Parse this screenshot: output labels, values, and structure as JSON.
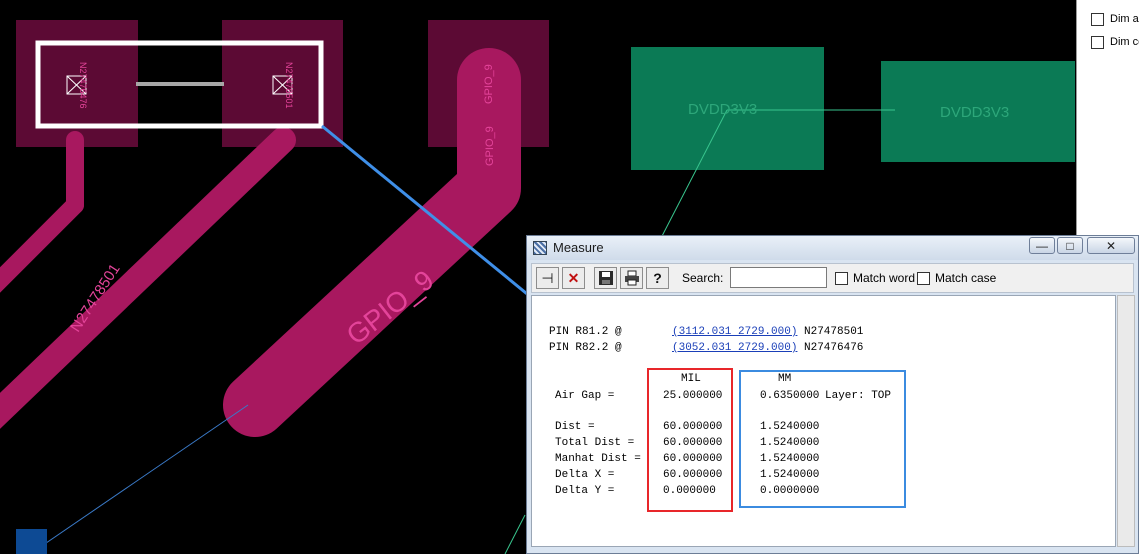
{
  "colors": {
    "background": "#000000",
    "pad": "#5c0a34",
    "trace": "#a8185f",
    "trace_label": "#e4449a",
    "copper_green": "#0b7a55",
    "green_label": "#2da77a",
    "highlight_white": "#ffffff",
    "arrow_blue": "#3f8fe8",
    "box_red": "#e8262a",
    "box_blue": "#3b8be0",
    "window_frame": "#d9e4f1"
  },
  "pcb": {
    "pad_labels": [
      "N27476476",
      "N27478501"
    ],
    "trace_labels": [
      "N27478501",
      "GPIO_9",
      "GPIO_9",
      "GPIO_9"
    ],
    "region_labels": [
      "DVDD3V3",
      "DVDD3V3"
    ]
  },
  "options_panel": {
    "items": [
      "Dim ac",
      "Dim cc"
    ]
  },
  "measure": {
    "title": "Measure",
    "window_buttons": {
      "minimize": "—",
      "maximize": "□",
      "close": "✕"
    },
    "toolbar": {
      "icons": [
        "pin-icon",
        "delete-icon",
        "save-icon",
        "print-icon",
        "help-icon"
      ],
      "search_label": "Search:",
      "search_value": "",
      "match_word": "Match word",
      "match_case": "Match case"
    },
    "pins": [
      {
        "label": "PIN R81.2 @",
        "coords": "(3112.031 2729.000)",
        "net": "N27478501"
      },
      {
        "label": "PIN R82.2 @",
        "coords": "(3052.031 2729.000)",
        "net": "N27476476"
      }
    ],
    "headers": {
      "mil": "MIL",
      "mm": "MM"
    },
    "air_gap": {
      "label": "Air Gap =",
      "mil": "25.000000",
      "mm": "0.6350000",
      "layer": "Layer: TOP"
    },
    "rows": [
      {
        "label": "Dist =",
        "mil": "60.000000",
        "mm": "1.5240000"
      },
      {
        "label": "Total Dist =",
        "mil": "60.000000",
        "mm": "1.5240000"
      },
      {
        "label": "Manhat Dist =",
        "mil": "60.000000",
        "mm": "1.5240000"
      },
      {
        "label": "Delta X =",
        "mil": "60.000000",
        "mm": "1.5240000"
      },
      {
        "label": "Delta Y =",
        "mil": "0.000000",
        "mm": "0.0000000"
      }
    ]
  }
}
